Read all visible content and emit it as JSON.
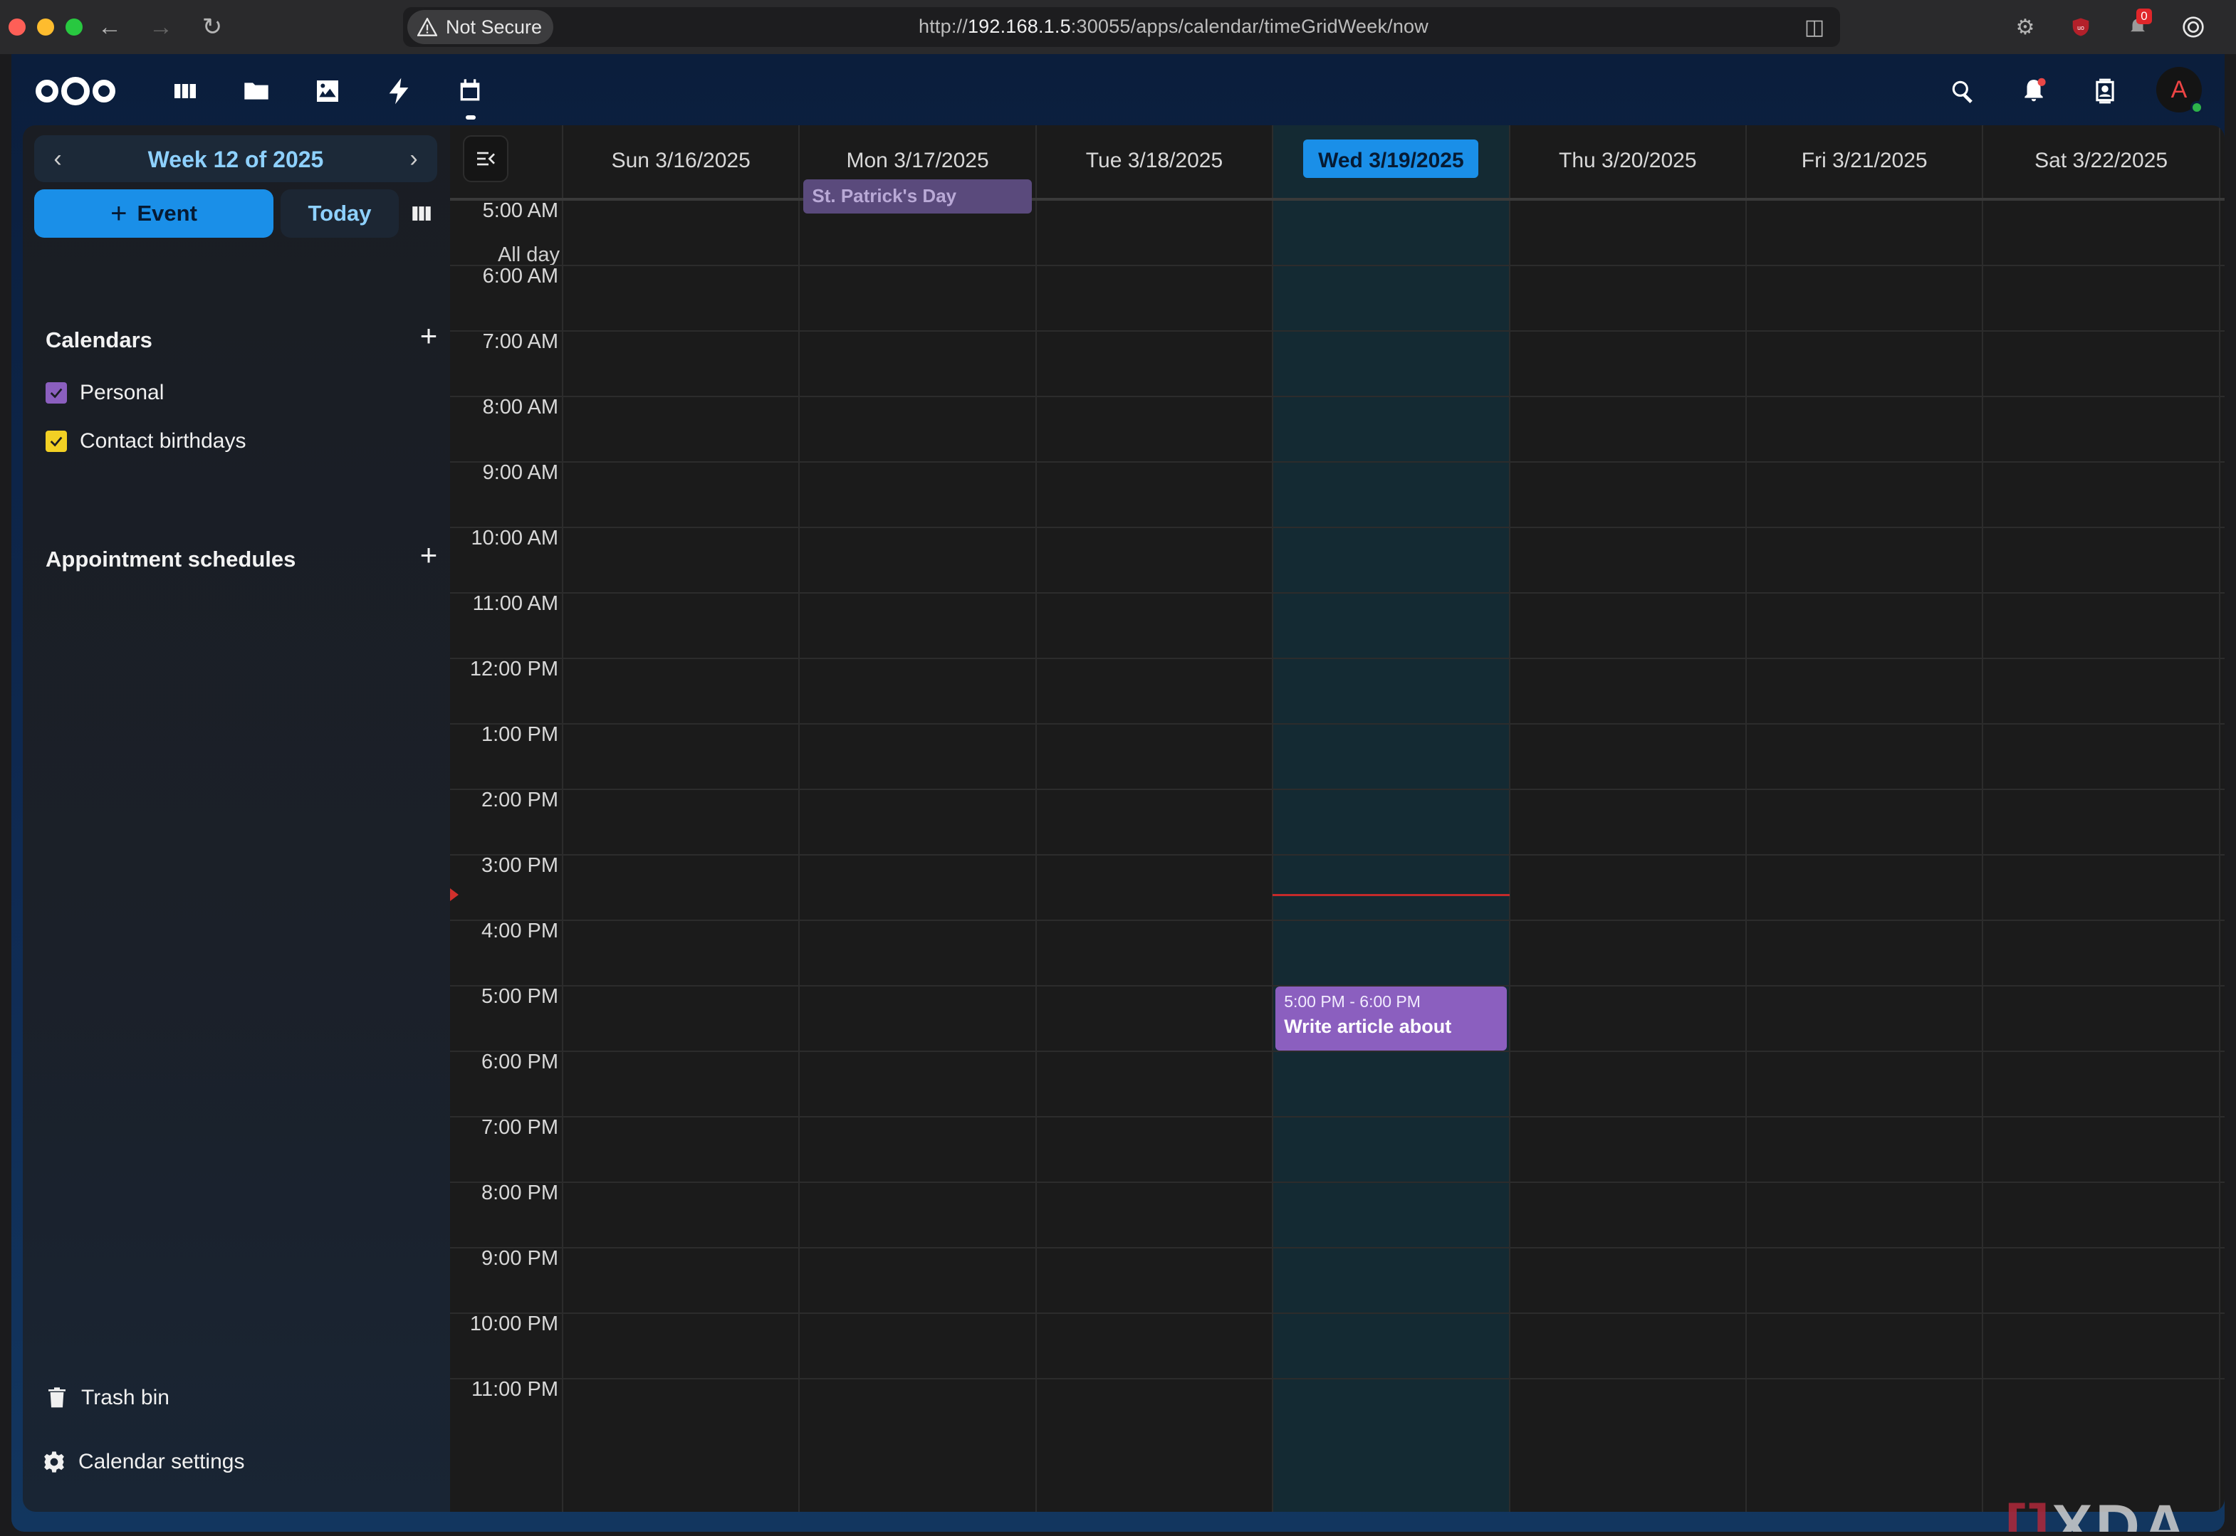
{
  "browser": {
    "not_secure": "Not Secure",
    "url_prefix": "http://",
    "url_host": "192.168.1.5",
    "url_rest": ":30055/apps/calendar/timeGridWeek/now",
    "extension_badge": "0"
  },
  "topnav": {
    "apps": [
      "dashboard-icon",
      "files-icon",
      "photos-icon",
      "activity-icon",
      "calendar-icon"
    ],
    "avatar_letter": "A"
  },
  "sidebar": {
    "week_label": "Week 12 of 2025",
    "new_event_label": "Event",
    "today_label": "Today",
    "calendars_title": "Calendars",
    "calendars": [
      {
        "label": "Personal",
        "color": "#8b5fbf"
      },
      {
        "label": "Contact birthdays",
        "color": "#f2d024"
      }
    ],
    "appointments_title": "Appointment schedules",
    "trash_label": "Trash bin",
    "settings_label": "Calendar settings"
  },
  "calendar": {
    "allday_label": "All day",
    "days": [
      "Sun 3/16/2025",
      "Mon 3/17/2025",
      "Tue 3/18/2025",
      "Wed 3/19/2025",
      "Thu 3/20/2025",
      "Fri 3/21/2025",
      "Sat 3/22/2025"
    ],
    "today_index": 3,
    "hours": [
      "5:00 AM",
      "6:00 AM",
      "7:00 AM",
      "8:00 AM",
      "9:00 AM",
      "10:00 AM",
      "11:00 AM",
      "12:00 PM",
      "1:00 PM",
      "2:00 PM",
      "3:00 PM",
      "4:00 PM",
      "5:00 PM",
      "6:00 PM",
      "7:00 PM",
      "8:00 PM",
      "9:00 PM",
      "10:00 PM",
      "11:00 PM"
    ],
    "allday_event": {
      "title": "St. Patrick's Day",
      "day_index": 1
    },
    "event": {
      "time": "5:00 PM - 6:00 PM",
      "title": "Write article about",
      "day_index": 3
    }
  },
  "watermark": {
    "text": "XDA"
  }
}
